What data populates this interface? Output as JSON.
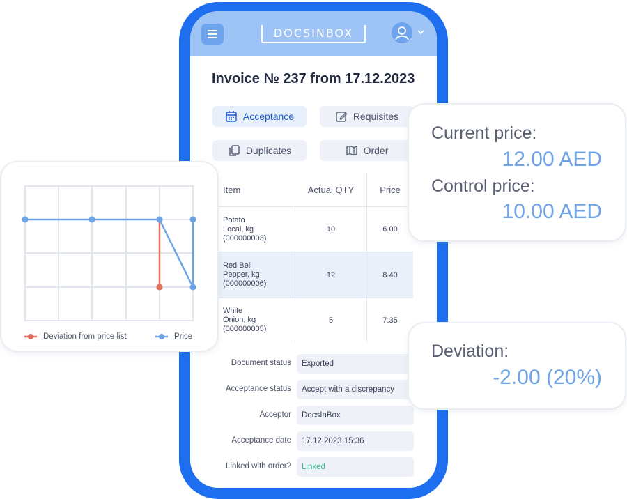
{
  "app": {
    "logo_text": "DOCSINBOX"
  },
  "invoice": {
    "title": "Invoice № 237 from 17.12.2023"
  },
  "tabs": [
    {
      "label": "Acceptance",
      "icon": "calendar-icon",
      "active": true
    },
    {
      "label": "Requisites",
      "icon": "edit-icon",
      "active": false
    },
    {
      "label": "Duplicates",
      "icon": "copy-icon",
      "active": false
    },
    {
      "label": "Order",
      "icon": "map-icon",
      "active": false
    }
  ],
  "table": {
    "headers": [
      "Item",
      "Actual QTY",
      "Price"
    ],
    "rows": [
      {
        "item": [
          "Potato",
          "Local, kg",
          "(000000003)"
        ],
        "qty": "10",
        "price": "6.00",
        "highlighted": false
      },
      {
        "item": [
          "Red Bell",
          "Pepper, kg",
          "(000000006)"
        ],
        "qty": "12",
        "price": "8.40",
        "highlighted": true
      },
      {
        "item": [
          "White",
          "Onion, kg",
          "(000000005)"
        ],
        "qty": "5",
        "price": "7.35",
        "highlighted": false
      }
    ]
  },
  "status": [
    {
      "label": "Document status",
      "value": "Exported"
    },
    {
      "label": "Acceptance status",
      "value": "Accept with a discrepancy"
    },
    {
      "label": "Acceptor",
      "value": "DocsInBox"
    },
    {
      "label": "Acceptance date",
      "value": "17.12.2023 15:36"
    },
    {
      "label": "Linked with order?",
      "value": "Linked"
    }
  ],
  "price_card": {
    "current_label": "Current price:",
    "current_value": "12.00 AED",
    "control_label": "Control price:",
    "control_value": "10.00 AED"
  },
  "deviation_card": {
    "label": "Deviation:",
    "value": "-2.00 (20%)"
  },
  "chart": {
    "legend": [
      {
        "name": "Deviation from price list",
        "color": "#e2705f"
      },
      {
        "name": "Price",
        "color": "#6ea3e6"
      }
    ]
  },
  "colors": {
    "phone": "#1d6ff0",
    "accent": "#6ea3e6",
    "deviation": "#e2705f",
    "linked": "#3bb28a"
  }
}
